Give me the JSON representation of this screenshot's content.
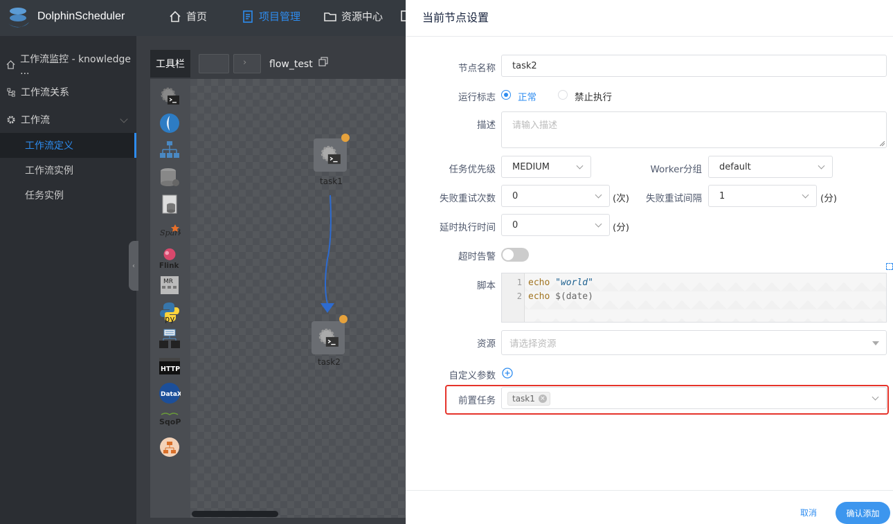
{
  "brand": "DolphinScheduler",
  "nav": {
    "home": "首页",
    "project": "项目管理",
    "resource": "资源中心"
  },
  "sidebar": {
    "monitor": "工作流监控 - knowledge ...",
    "relation": "工作流关系",
    "workflow": "工作流",
    "definition": "工作流定义",
    "instance": "工作流实例",
    "task_instance": "任务实例"
  },
  "canvas": {
    "toolbar_label": "工具栏",
    "flow_name": "flow_test",
    "node1_label": "task1",
    "node2_label": "task2"
  },
  "drawer": {
    "title": "当前节点设置",
    "node_name_label": "节点名称",
    "node_name_value": "task2",
    "run_flag_label": "运行标志",
    "run_normal": "正常",
    "run_forbid": "禁止执行",
    "desc_label": "描述",
    "desc_placeholder": "请输入描述",
    "priority_label": "任务优先级",
    "priority_value": "MEDIUM",
    "worker_label": "Worker分组",
    "worker_value": "default",
    "retry_times_label": "失败重试次数",
    "retry_times_value": "0",
    "retry_times_unit": "(次)",
    "retry_interval_label": "失败重试间隔",
    "retry_interval_value": "1",
    "retry_interval_unit": "(分)",
    "delay_label": "延时执行时间",
    "delay_value": "0",
    "delay_unit": "(分)",
    "timeout_label": "超时告警",
    "script_label": "脚本",
    "script_lines": [
      {
        "num": "1",
        "kw": "echo",
        "rest": "\"world\""
      },
      {
        "num": "2",
        "kw": "echo",
        "rest": "$(date)"
      }
    ],
    "resource_label": "资源",
    "resource_placeholder": "请选择资源",
    "custom_params_label": "自定义参数",
    "pre_task_label": "前置任务",
    "pre_task_tag": "task1",
    "cancel": "取消",
    "confirm": "确认添加"
  },
  "colors": {
    "accent": "#2d8cf0",
    "highlight": "#e5332a",
    "node_dot": "#e6a23c"
  }
}
